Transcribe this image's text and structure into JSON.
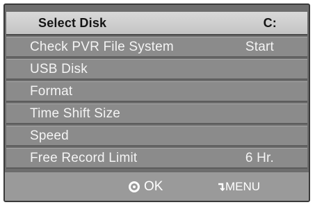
{
  "menu": {
    "items": [
      {
        "label": "Select Disk",
        "value": "C:"
      },
      {
        "label": "Check PVR File System",
        "value": "Start"
      },
      {
        "label": "USB Disk",
        "value": ""
      },
      {
        "label": "Format",
        "value": ""
      },
      {
        "label": "Time Shift Size",
        "value": ""
      },
      {
        "label": "Speed",
        "value": ""
      },
      {
        "label": "Free Record Limit",
        "value": "6 Hr."
      }
    ]
  },
  "footer": {
    "ok_label": "OK",
    "menu_label": "MENU",
    "ok_icon": "ok-circle-icon",
    "menu_icon": "return-arrow-icon"
  }
}
